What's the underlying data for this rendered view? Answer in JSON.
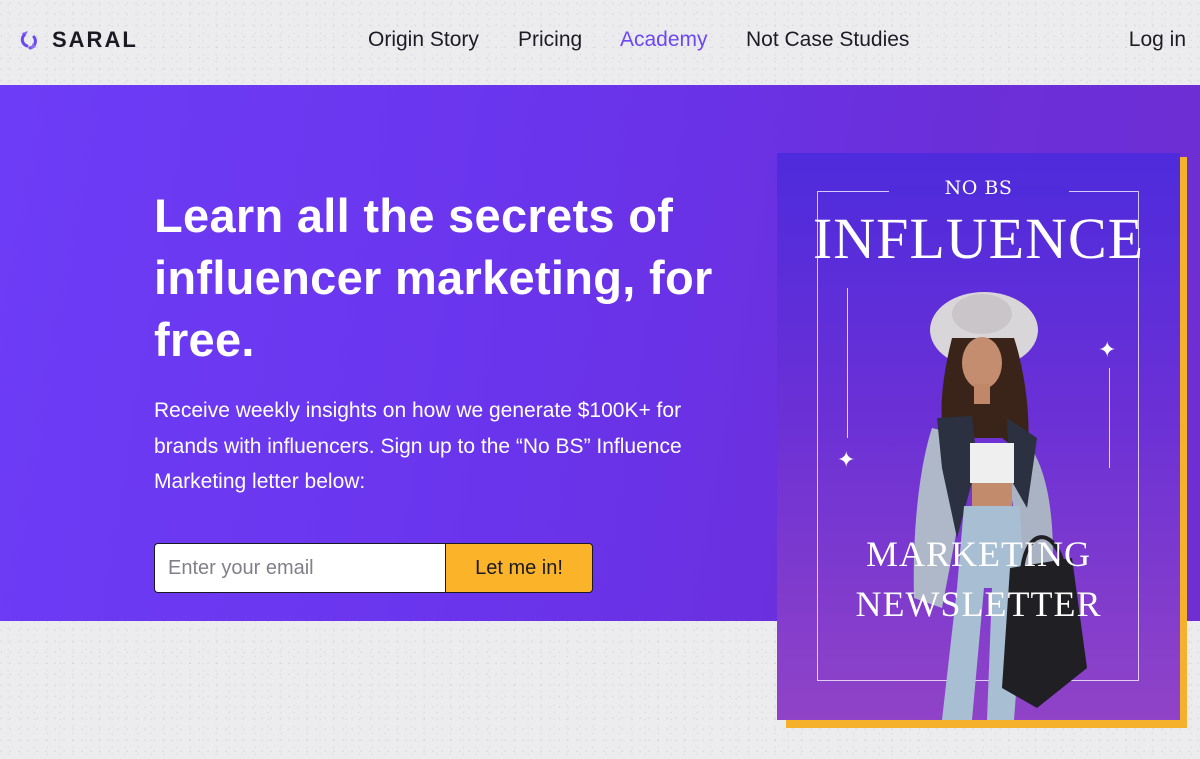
{
  "nav": {
    "logo_text": "SARAL",
    "links": [
      "Origin Story",
      "Pricing",
      "Academy",
      "Not Case Studies"
    ],
    "active_link": "Academy",
    "login": "Log in"
  },
  "hero": {
    "headline": "Learn all the secrets of influencer marketing, for free.",
    "subtext": "Receive weekly insights on how we generate $100K+ for brands with influencers. Sign up to the “No BS” Influence Marketing letter below:",
    "email_placeholder": "Enter your email",
    "submit_label": "Let me in!"
  },
  "card": {
    "kicker": "NO BS",
    "title": "INFLUENCE",
    "sub1": "MARKETING",
    "sub2": "NEWSLETTER"
  },
  "colors": {
    "accent": "#6a48f2",
    "hero_bg": "#6a34ec",
    "button": "#fbb42a",
    "card_shadow": "#f5b12c"
  }
}
